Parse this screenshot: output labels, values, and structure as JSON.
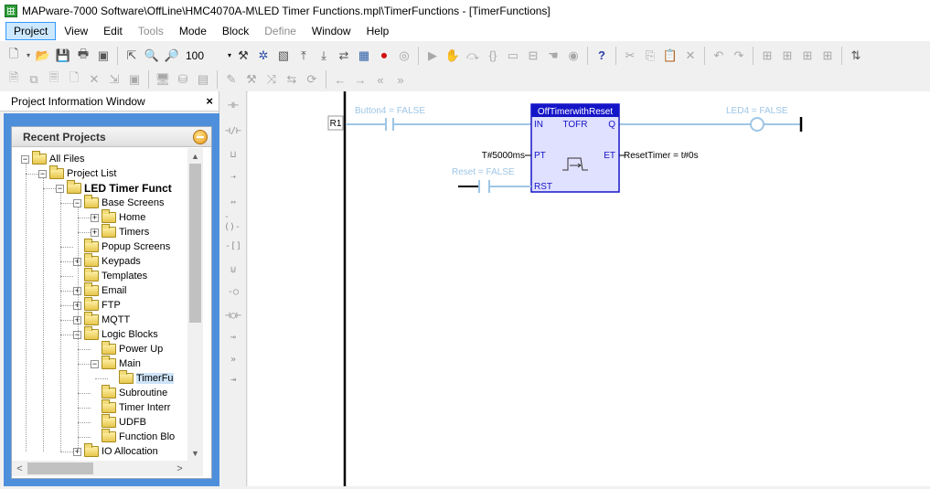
{
  "window": {
    "title": "MAPware-7000 Software\\OffLine\\HMC4070A-M\\LED Timer Functions.mpl\\TimerFunctions - [TimerFunctions]"
  },
  "menu": [
    {
      "label": "Project",
      "state": "active"
    },
    {
      "label": "View",
      "state": "normal"
    },
    {
      "label": "Edit",
      "state": "normal"
    },
    {
      "label": "Tools",
      "state": "disabled"
    },
    {
      "label": "Mode",
      "state": "normal"
    },
    {
      "label": "Block",
      "state": "normal"
    },
    {
      "label": "Define",
      "state": "disabled"
    },
    {
      "label": "Window",
      "state": "normal"
    },
    {
      "label": "Help",
      "state": "normal"
    }
  ],
  "toolbar": {
    "zoom_value": "100"
  },
  "panel": {
    "title": "Project Information Window",
    "close_glyph": "×",
    "recent_title": "Recent Projects"
  },
  "tree": [
    {
      "label": "All Files",
      "depth": 0,
      "expander": "−",
      "folder": true
    },
    {
      "label": "Project List",
      "depth": 1,
      "expander": "−",
      "folder": true
    },
    {
      "label": "LED Timer Funct",
      "depth": 2,
      "expander": "−",
      "folder": true,
      "bold": true
    },
    {
      "label": "Base Screens",
      "depth": 3,
      "expander": "−",
      "folder": true
    },
    {
      "label": "Home",
      "depth": 4,
      "expander": "+",
      "folder": true
    },
    {
      "label": "Timers",
      "depth": 4,
      "expander": "+",
      "folder": true
    },
    {
      "label": "Popup Screens",
      "depth": 3,
      "expander": "",
      "folder": true
    },
    {
      "label": "Keypads",
      "depth": 3,
      "expander": "+",
      "folder": true
    },
    {
      "label": "Templates",
      "depth": 3,
      "expander": "",
      "folder": true
    },
    {
      "label": "Email",
      "depth": 3,
      "expander": "+",
      "folder": true
    },
    {
      "label": "FTP",
      "depth": 3,
      "expander": "+",
      "folder": true
    },
    {
      "label": "MQTT",
      "depth": 3,
      "expander": "+",
      "folder": true
    },
    {
      "label": "Logic Blocks",
      "depth": 3,
      "expander": "−",
      "folder": true
    },
    {
      "label": "Power Up",
      "depth": 4,
      "expander": "",
      "folder": true
    },
    {
      "label": "Main",
      "depth": 4,
      "expander": "−",
      "folder": true
    },
    {
      "label": "TimerFu",
      "depth": 5,
      "expander": "",
      "folder": true,
      "selected": true
    },
    {
      "label": "Subroutine",
      "depth": 4,
      "expander": "",
      "folder": true
    },
    {
      "label": "Timer Interr",
      "depth": 4,
      "expander": "",
      "folder": true
    },
    {
      "label": "UDFB",
      "depth": 4,
      "expander": "",
      "folder": true
    },
    {
      "label": "Function Blo",
      "depth": 4,
      "expander": "",
      "folder": true
    },
    {
      "label": "IO Allocation",
      "depth": 3,
      "expander": "+",
      "folder": true
    }
  ],
  "ladder": {
    "rung_label": "R1",
    "contact_in": "Button4 = FALSE",
    "contact_rst": "Reset = FALSE",
    "coil": "LED4 = FALSE",
    "block": {
      "instance": "OffTimerwithReset",
      "type": "TOFR",
      "pin_in": "IN",
      "pin_q": "Q",
      "pin_pt": "PT",
      "pin_et": "ET",
      "pin_rst": "RST",
      "pt_value": "T#5000ms",
      "et_value": "ResetTimer = t#0s"
    },
    "colors": {
      "block_header": "#1515c8",
      "block_fill": "#e0e0ff",
      "inactive": "#9ec6e6",
      "rail": "#000000"
    }
  }
}
